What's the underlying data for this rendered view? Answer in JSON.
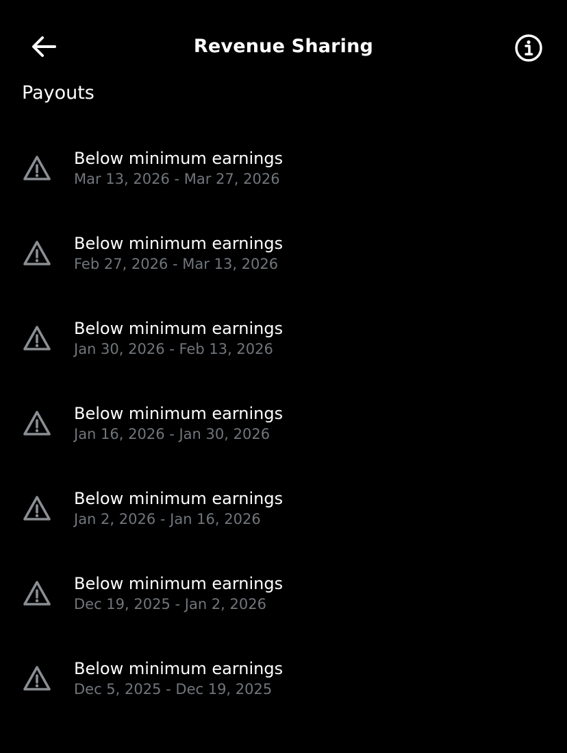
{
  "header": {
    "title": "Revenue Sharing",
    "back_icon": "arrow-left-icon",
    "info_icon": "info-circle-icon"
  },
  "section": {
    "title": "Payouts"
  },
  "payouts": [
    {
      "status": "Below minimum earnings",
      "range": "Mar 13, 2026 - Mar 27, 2026",
      "icon": "warning-triangle-icon"
    },
    {
      "status": "Below minimum earnings",
      "range": "Feb 27, 2026 - Mar 13, 2026",
      "icon": "warning-triangle-icon"
    },
    {
      "status": "Below minimum earnings",
      "range": "Jan 30, 2026 - Feb 13, 2026",
      "icon": "warning-triangle-icon"
    },
    {
      "status": "Below minimum earnings",
      "range": "Jan 16, 2026 - Jan 30, 2026",
      "icon": "warning-triangle-icon"
    },
    {
      "status": "Below minimum earnings",
      "range": "Jan 2, 2026 - Jan 16, 2026",
      "icon": "warning-triangle-icon"
    },
    {
      "status": "Below minimum earnings",
      "range": "Dec 19, 2025 - Jan 2, 2026",
      "icon": "warning-triangle-icon"
    },
    {
      "status": "Below minimum earnings",
      "range": "Dec 5, 2025 - Dec 19, 2025",
      "icon": "warning-triangle-icon"
    }
  ],
  "colors": {
    "background": "#000000",
    "primary_text": "#ffffff",
    "secondary_text": "#71767b",
    "icon_gray": "#8b8f93"
  }
}
